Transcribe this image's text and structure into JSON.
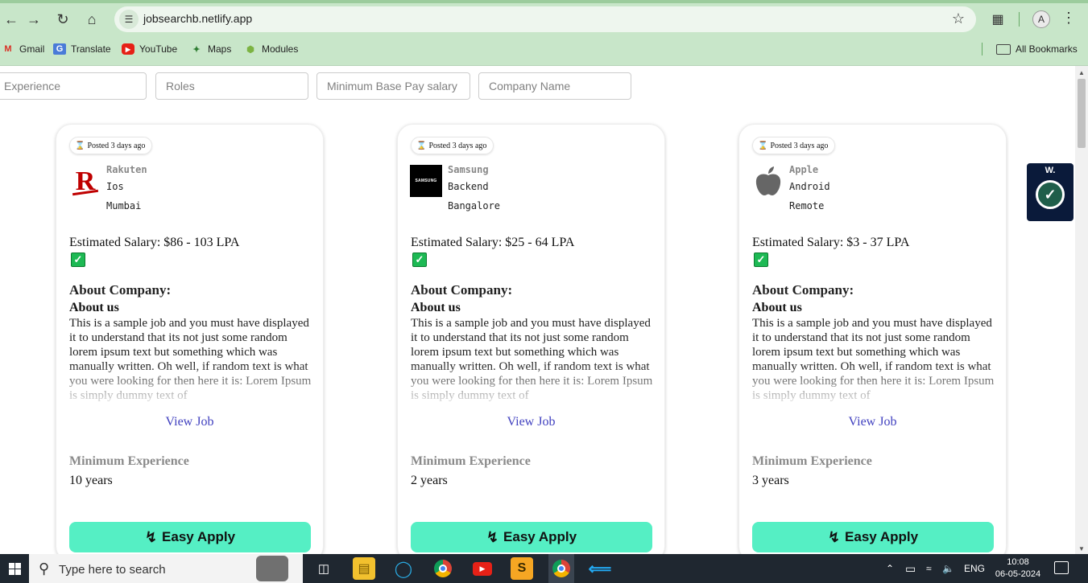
{
  "browser": {
    "url": "jobsearchb.netlify.app",
    "profile_initial": "A",
    "bookmarks": [
      "Gmail",
      "Translate",
      "YouTube",
      "Maps",
      "Modules"
    ],
    "all_bookmarks": "All Bookmarks"
  },
  "filters": {
    "experience": "Experience",
    "roles": "Roles",
    "min_base_pay": "Minimum Base Pay salary",
    "company_name": "Company Name"
  },
  "jobs": [
    {
      "posted": "Posted 3 days ago",
      "company": "Rakuten",
      "role": "Ios",
      "location": "Mumbai",
      "salary": "Estimated Salary: $86 - 103 LPA",
      "about_heading": "About Company:",
      "about_sub": "About us",
      "about_text": "This is a sample job and you must have displayed it to understand that its not just some random lorem ipsum text but something which was manually written. Oh well, if random text is what you were looking for then here it is: Lorem Ipsum is simply dummy text of",
      "view_job": "View Job",
      "min_exp_label": "Minimum Experience",
      "min_exp": "10 years",
      "apply": "Easy Apply",
      "logo_icon": "rakuten-logo"
    },
    {
      "posted": "Posted 3 days ago",
      "company": "Samsung",
      "role": "Backend",
      "location": "Bangalore",
      "salary": "Estimated Salary: $25 - 64 LPA",
      "about_heading": "About Company:",
      "about_sub": "About us",
      "about_text": "This is a sample job and you must have displayed it to understand that its not just some random lorem ipsum text but something which was manually written. Oh well, if random text is what you were looking for then here it is: Lorem Ipsum is simply dummy text of",
      "view_job": "View Job",
      "min_exp_label": "Minimum Experience",
      "min_exp": "2 years",
      "apply": "Easy Apply",
      "logo_icon": "samsung-logo",
      "logo_text": "SAMSUNG"
    },
    {
      "posted": "Posted 3 days ago",
      "company": "Apple",
      "role": "Android",
      "location": "Remote",
      "salary": "Estimated Salary: $3 - 37 LPA",
      "about_heading": "About Company:",
      "about_sub": "About us",
      "about_text": "This is a sample job and you must have displayed it to understand that its not just some random lorem ipsum text but something which was manually written. Oh well, if random text is what you were looking for then here it is: Lorem Ipsum is simply dummy text of",
      "view_job": "View Job",
      "min_exp_label": "Minimum Experience",
      "min_exp": "3 years",
      "apply": "Easy Apply",
      "logo_icon": "apple-logo"
    }
  ],
  "widget": {
    "title": "W."
  },
  "taskbar": {
    "search_placeholder": "Type here to search",
    "language": "ENG",
    "time": "10:08",
    "date": "06-05-2024"
  },
  "colors": {
    "chrome_bg": "#c8e6c9",
    "apply_button": "#55efc4",
    "link": "#3f3fbf",
    "widget_bg": "#0a1a3a",
    "taskbar_bg": "#1f2730"
  }
}
